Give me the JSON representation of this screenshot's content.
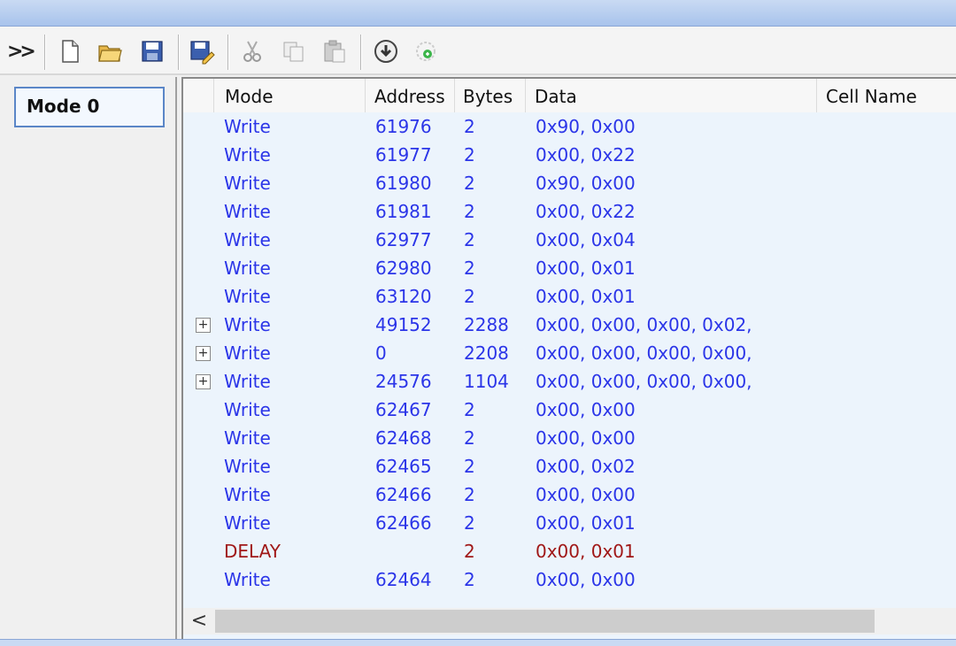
{
  "toolbar": {
    "icons": [
      "chevron-double-right-icon",
      "new-file-icon",
      "open-folder-icon",
      "save-icon",
      "save-as-icon",
      "cut-icon",
      "copy-icon",
      "paste-icon",
      "download-icon",
      "refresh-icon"
    ]
  },
  "left_panel": {
    "mode_label": "Mode 0"
  },
  "table": {
    "columns": [
      "Mode",
      "Address",
      "Bytes",
      "Data",
      "Cell Name"
    ],
    "rows": [
      {
        "mode": "Write",
        "address": "61976",
        "bytes": "2",
        "data": "0x90, 0x00",
        "expand": false,
        "color": "#2b35e8"
      },
      {
        "mode": "Write",
        "address": "61977",
        "bytes": "2",
        "data": "0x00, 0x22",
        "expand": false,
        "color": "#2b35e8"
      },
      {
        "mode": "Write",
        "address": "61980",
        "bytes": "2",
        "data": "0x90, 0x00",
        "expand": false,
        "color": "#2b35e8"
      },
      {
        "mode": "Write",
        "address": "61981",
        "bytes": "2",
        "data": "0x00, 0x22",
        "expand": false,
        "color": "#2b35e8"
      },
      {
        "mode": "Write",
        "address": "62977",
        "bytes": "2",
        "data": "0x00, 0x04",
        "expand": false,
        "color": "#2b35e8"
      },
      {
        "mode": "Write",
        "address": "62980",
        "bytes": "2",
        "data": "0x00, 0x01",
        "expand": false,
        "color": "#2b35e8"
      },
      {
        "mode": "Write",
        "address": "63120",
        "bytes": "2",
        "data": "0x00, 0x01",
        "expand": false,
        "color": "#2b35e8"
      },
      {
        "mode": "Write",
        "address": "49152",
        "bytes": "2288",
        "data": "0x00, 0x00, 0x00, 0x02,",
        "expand": true,
        "color": "#2b35e8"
      },
      {
        "mode": "Write",
        "address": "0",
        "bytes": "2208",
        "data": "0x00, 0x00, 0x00, 0x00,",
        "expand": true,
        "color": "#2b35e8"
      },
      {
        "mode": "Write",
        "address": "24576",
        "bytes": "1104",
        "data": "0x00, 0x00, 0x00, 0x00,",
        "expand": true,
        "color": "#2b35e8"
      },
      {
        "mode": "Write",
        "address": "62467",
        "bytes": "2",
        "data": "0x00, 0x00",
        "expand": false,
        "color": "#2b35e8"
      },
      {
        "mode": "Write",
        "address": "62468",
        "bytes": "2",
        "data": "0x00, 0x00",
        "expand": false,
        "color": "#2b35e8"
      },
      {
        "mode": "Write",
        "address": "62465",
        "bytes": "2",
        "data": "0x00, 0x02",
        "expand": false,
        "color": "#2b35e8"
      },
      {
        "mode": "Write",
        "address": "62466",
        "bytes": "2",
        "data": "0x00, 0x00",
        "expand": false,
        "color": "#2b35e8"
      },
      {
        "mode": "Write",
        "address": "62466",
        "bytes": "2",
        "data": "0x00, 0x01",
        "expand": false,
        "color": "#2b35e8"
      },
      {
        "mode": "DELAY",
        "address": "",
        "bytes": "2",
        "data": "0x00, 0x01",
        "expand": false,
        "color": "#a01818"
      },
      {
        "mode": "Write",
        "address": "62464",
        "bytes": "2",
        "data": "0x00, 0x00",
        "expand": false,
        "color": "#2b35e8"
      }
    ]
  },
  "scrollbar": {
    "left_arrow": "<"
  }
}
